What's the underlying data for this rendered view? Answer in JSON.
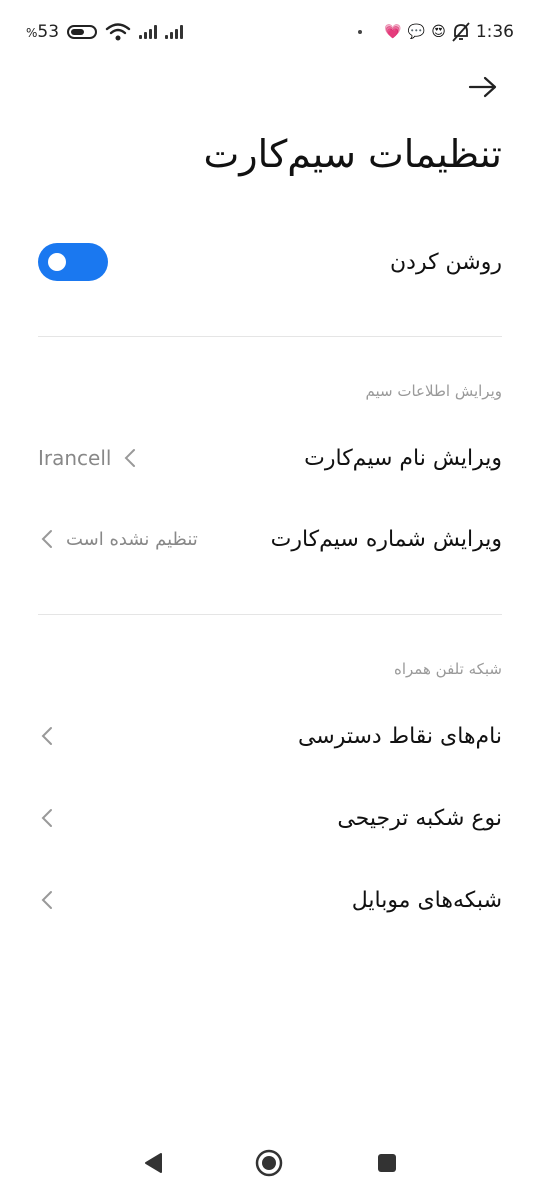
{
  "status_bar": {
    "battery_percent": "53",
    "percent_sign": "%",
    "time": "1:36"
  },
  "page": {
    "title": "تنظیمات سیم‌کارت"
  },
  "toggle": {
    "label": "روشن کردن",
    "state": "on",
    "accent": "#1a78f0"
  },
  "sections": {
    "sim_info": {
      "title": "ویرایش اطلاعات سیم",
      "items": [
        {
          "label": "ویرایش نام سیم‌کارت",
          "value": "Irancell"
        },
        {
          "label": "ویرایش شماره سیم‌کارت",
          "value": "تنظیم نشده است"
        }
      ]
    },
    "mobile_network": {
      "title": "شبکه تلفن همراه",
      "items": [
        {
          "label": "نام‌های نقاط دسترسی"
        },
        {
          "label": "نوع شکبه ترجیحی"
        },
        {
          "label": "شبکه‌های موبایل"
        }
      ]
    }
  },
  "icons": {
    "back": "arrow-right-icon",
    "chevron": "chevron-left-icon",
    "nav_back": "triangle-back-icon",
    "nav_home": "circle-home-icon",
    "nav_recents": "square-recents-icon"
  }
}
